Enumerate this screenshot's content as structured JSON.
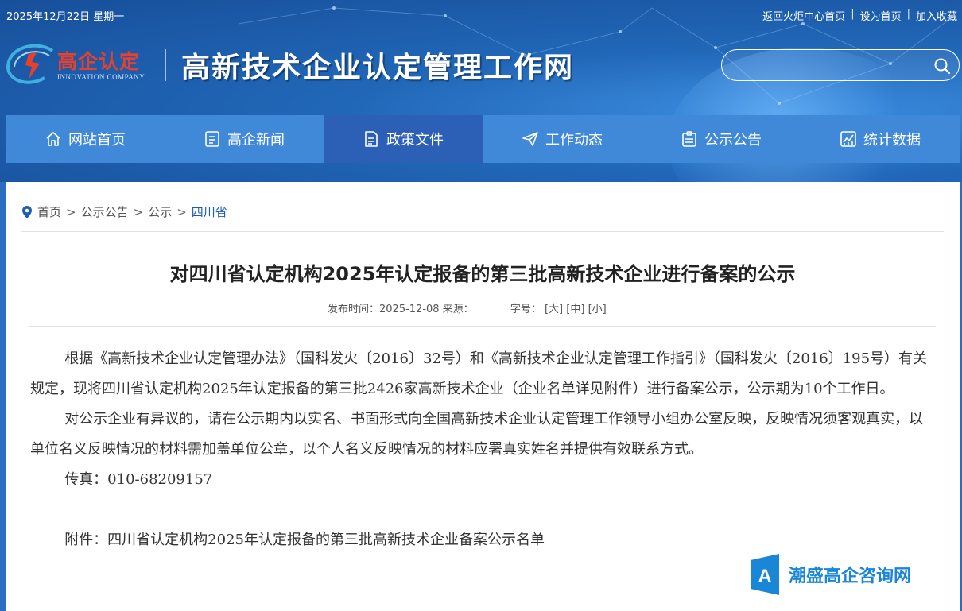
{
  "header": {
    "date": "2025年12月22日 星期一",
    "links": [
      "返回火炬中心首页",
      "设为首页",
      "加入收藏"
    ],
    "logo_cn": "高企认定",
    "logo_en": "INNOVATION COMPANY",
    "site_title": "高新技术企业认定管理工作网",
    "search_placeholder": ""
  },
  "nav": [
    {
      "label": "网站首页",
      "icon": "home-icon"
    },
    {
      "label": "高企新闻",
      "icon": "news-icon"
    },
    {
      "label": "政策文件",
      "icon": "document-icon",
      "active": true
    },
    {
      "label": "工作动态",
      "icon": "send-icon"
    },
    {
      "label": "公示公告",
      "icon": "clipboard-icon"
    },
    {
      "label": "统计数据",
      "icon": "chart-icon"
    }
  ],
  "breadcrumb": [
    "首页",
    "公示公告",
    "公示",
    "四川省"
  ],
  "article": {
    "title": "对四川省认定机构2025年认定报备的第三批高新技术企业进行备案的公示",
    "meta_publish": "发布时间：2025-12-08 来源：",
    "meta_size_label": "字号：",
    "size_options": [
      "[大]",
      "[中]",
      "[小]"
    ],
    "paragraphs": [
      "根据《高新技术企业认定管理办法》（国科发火〔2016〕32号）和《高新技术企业认定管理工作指引》（国科发火〔2016〕195号）有关规定，现将四川省认定机构2025年认定报备的第三批2426家高新技术企业（企业名单详见附件）进行备案公示，公示期为10个工作日。",
      "对公示企业有异议的，请在公示期内以实名、书面形式向全国高新技术企业认定管理工作领导小组办公室反映，反映情况须客观真实，以单位名义反映情况的材料需加盖单位公章，以个人名义反映情况的材料应署真实姓名并提供有效联系方式。",
      "传真：010-68209157"
    ],
    "attachment": "附件：四川省认定机构2025年认定报备的第三批高新技术企业备案公示名单"
  },
  "watermark": "潮盛高企咨询网"
}
